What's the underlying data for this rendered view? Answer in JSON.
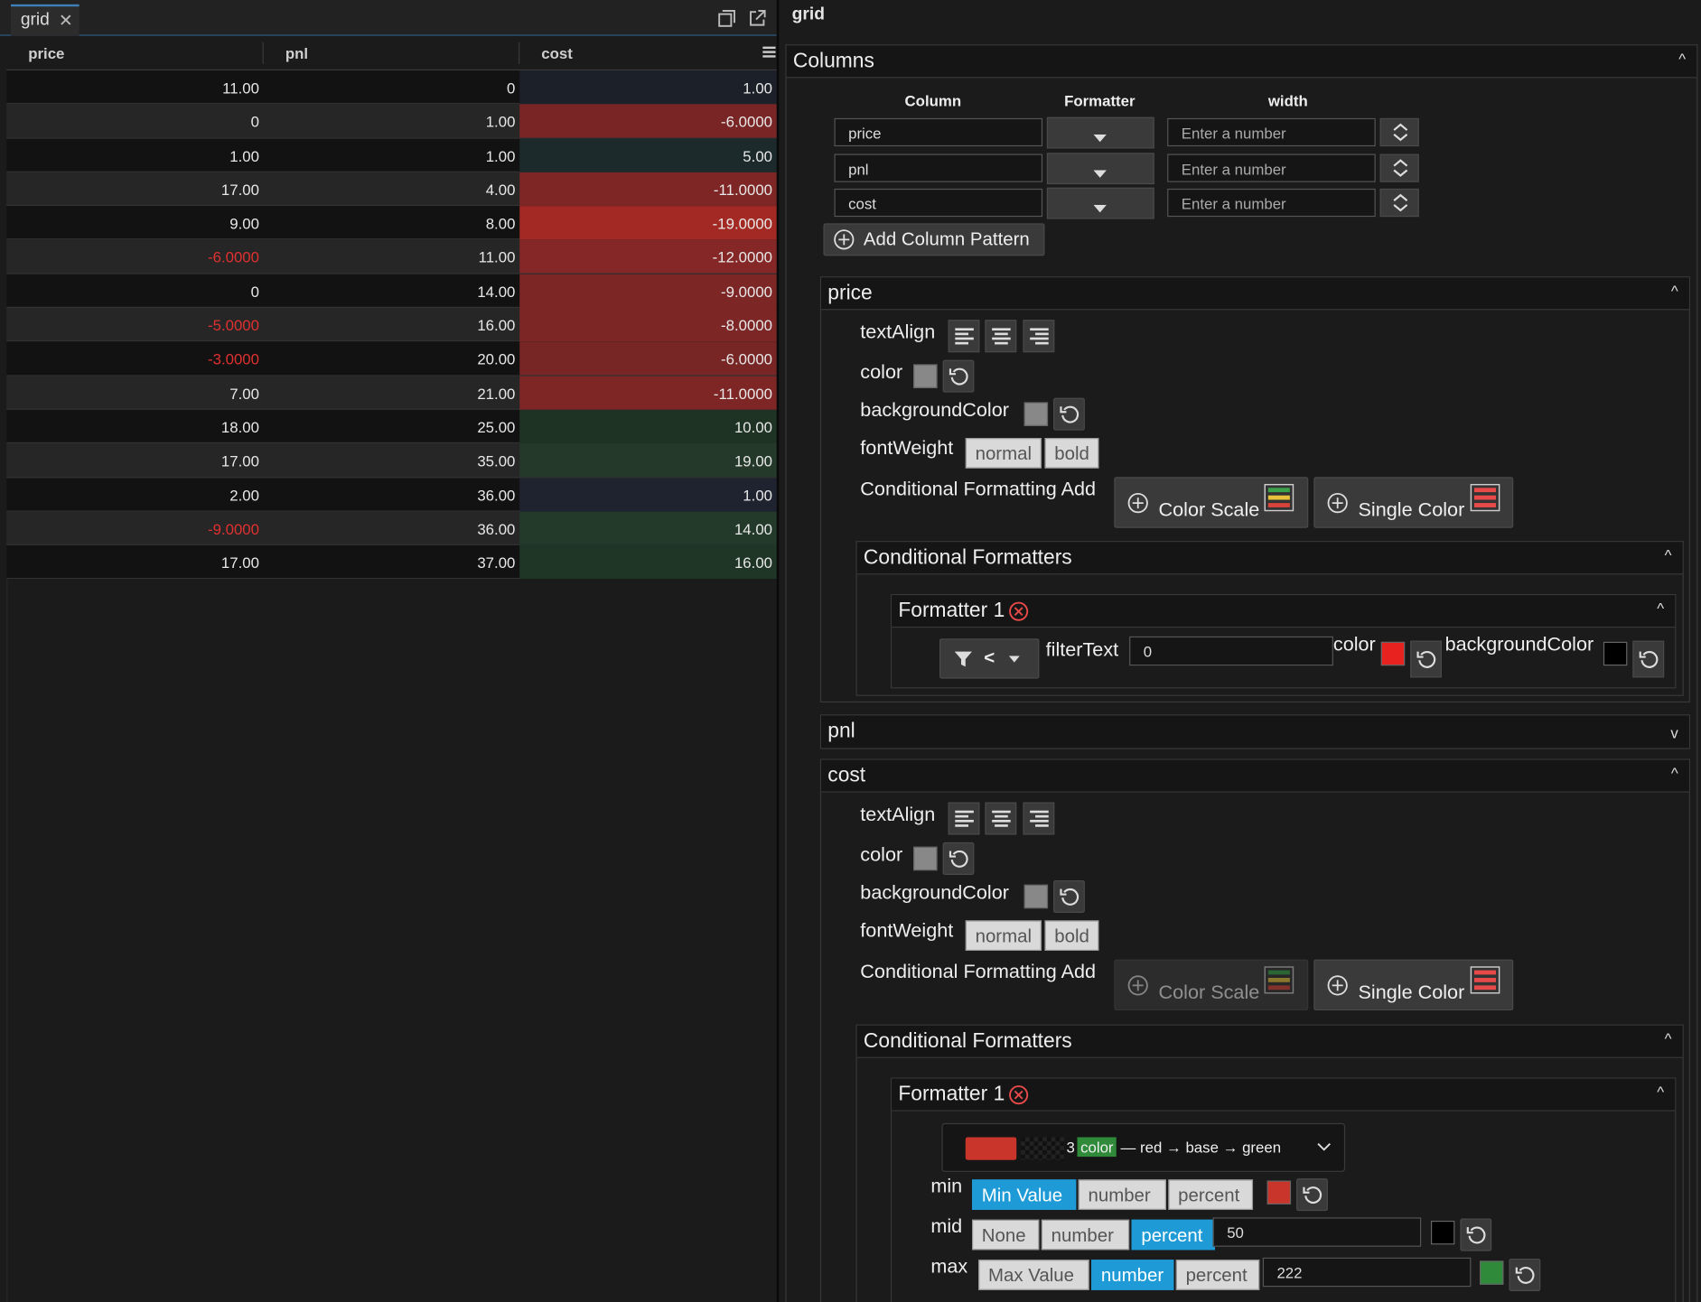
{
  "tab": {
    "label": "grid"
  },
  "grid": {
    "columns": [
      "price",
      "pnl",
      "cost"
    ],
    "rows": [
      [
        "11.00",
        "0",
        "1.00"
      ],
      [
        "0",
        "1.00",
        "-6.0000"
      ],
      [
        "1.00",
        "1.00",
        "5.00"
      ],
      [
        "17.00",
        "4.00",
        "-11.0000"
      ],
      [
        "9.00",
        "8.00",
        "-19.0000"
      ],
      [
        "-6.0000",
        "11.00",
        "-12.0000"
      ],
      [
        "0",
        "14.00",
        "-9.0000"
      ],
      [
        "-5.0000",
        "16.00",
        "-8.0000"
      ],
      [
        "-3.0000",
        "20.00",
        "-6.0000"
      ],
      [
        "7.00",
        "21.00",
        "-11.0000"
      ],
      [
        "18.00",
        "25.00",
        "10.00"
      ],
      [
        "17.00",
        "35.00",
        "19.00"
      ],
      [
        "2.00",
        "36.00",
        "1.00"
      ],
      [
        "-9.0000",
        "36.00",
        "14.00"
      ],
      [
        "17.00",
        "37.00",
        "16.00"
      ]
    ],
    "cost_bg": [
      "#1c2028",
      "#7a2525",
      "#1c2a2c",
      "#7e2626",
      "#a32a24",
      "#852727",
      "#7d2626",
      "#7c2626",
      "#782525",
      "#7e2626",
      "#1f3325",
      "#24392a",
      "#1f2330",
      "#233a2a",
      "#1f3526"
    ],
    "row_bg": [
      "#121212",
      "#262626"
    ]
  },
  "panel": {
    "title": "grid",
    "columns_section": {
      "title": "Columns",
      "headers": {
        "column": "Column",
        "formatter": "Formatter",
        "width": "width"
      },
      "patterns": [
        "price",
        "pnl",
        "cost"
      ],
      "width_placeholder": "Enter a number",
      "add_label": "Add Column Pattern"
    },
    "price": {
      "title": "price",
      "text_align_label": "textAlign",
      "color_label": "color",
      "bg_label": "backgroundColor",
      "font_weight_label": "fontWeight",
      "fw_normal": "normal",
      "fw_bold": "bold",
      "cf_add_label": "Conditional Formatting Add",
      "color_scale": "Color Scale",
      "single_color": "Single Color",
      "cf_title": "Conditional Formatters",
      "formatter_title": "Formatter 1",
      "filter_op": "<",
      "filter_text_label": "filterText",
      "filter_text_value": "0",
      "f_color_label": "color",
      "f_color": "#e8231f",
      "f_bg_label": "backgroundColor",
      "f_bg": "#000000"
    },
    "pnl": {
      "title": "pnl"
    },
    "cost": {
      "title": "cost",
      "text_align_label": "textAlign",
      "color_label": "color",
      "bg_label": "backgroundColor",
      "font_weight_label": "fontWeight",
      "fw_normal": "normal",
      "fw_bold": "bold",
      "cf_add_label": "Conditional Formatting Add",
      "color_scale": "Color Scale",
      "single_color": "Single Color",
      "cf_title": "Conditional Formatters",
      "formatter_title": "Formatter 1",
      "scale_count": "3",
      "scale_tag": "color",
      "scale_desc": "— red → base → green",
      "min_label": "min",
      "mid_label": "mid",
      "max_label": "max",
      "min_opts": [
        "Min Value",
        "number",
        "percent"
      ],
      "mid_opts": [
        "None",
        "number",
        "percent"
      ],
      "max_opts": [
        "Max Value",
        "number",
        "percent"
      ],
      "mid_value": "50",
      "max_value": "222",
      "min_color": "#c9352b",
      "mid_color": "#000000",
      "max_color": "#2f8a3a"
    }
  },
  "colors": {
    "accent": "#1e9bd7",
    "negative": "#e03030"
  }
}
